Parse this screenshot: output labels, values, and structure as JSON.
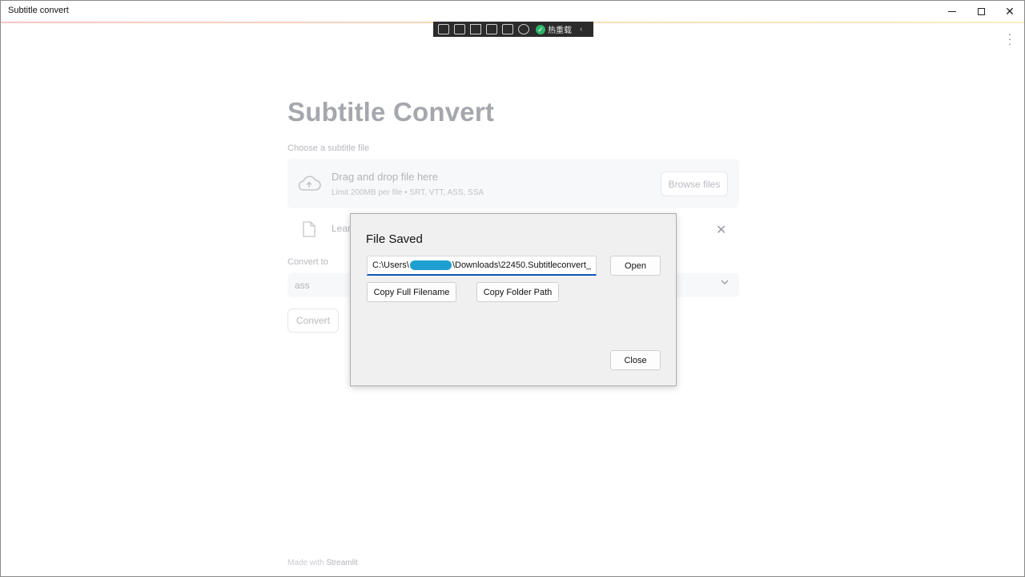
{
  "window": {
    "title": "Subtitle convert"
  },
  "devbar": {
    "hot_reload_label": "热重载",
    "colors": {
      "background": "#2b2b2b",
      "check": "#2fb36a"
    }
  },
  "app": {
    "title": "Subtitle Convert",
    "uploader": {
      "label": "Choose a subtitle file",
      "drop_text": "Drag and drop file here",
      "limit_text": "Limit 200MB per file • SRT, VTT, ASS, SSA",
      "browse_label": "Browse files"
    },
    "uploaded_file": {
      "name_visible": "Lear"
    },
    "convert_to": {
      "label": "Convert to",
      "selected": "ass"
    },
    "convert_button": "Convert",
    "footer": {
      "prefix": "Made with ",
      "brand": "Streamlit"
    }
  },
  "dialog": {
    "title": "File Saved",
    "path_prefix": "C:\\Users\\",
    "path_suffix": "\\Downloads\\22450.Subtitleconvert_",
    "open_label": "Open",
    "copy_full_label": "Copy Full Filename",
    "copy_folder_label": "Copy Folder Path",
    "close_label": "Close",
    "colors": {
      "focus_underline": "#0a59b8",
      "redaction": "#1f9fd1"
    }
  }
}
